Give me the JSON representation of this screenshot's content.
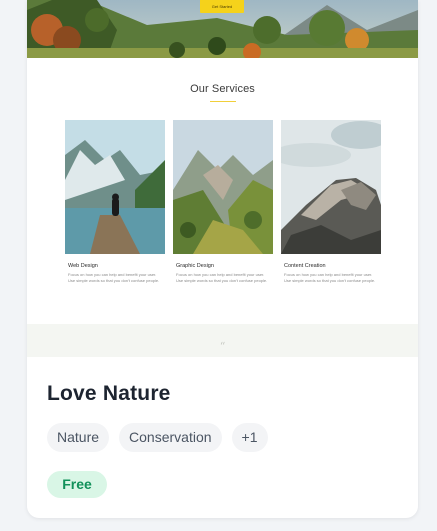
{
  "preview": {
    "hero_button_label": "Get Started",
    "services_title": "Our Services",
    "services": [
      {
        "title": "Web Design",
        "description": "Focus on how you can help and benefit your user. Use simple words so that you don't confuse people."
      },
      {
        "title": "Graphic Design",
        "description": "Focus on how you can help and benefit your user. Use simple words so that you don't confuse people."
      },
      {
        "title": "Content Creation",
        "description": "Focus on how you can help and benefit your user. Use simple words so that you don't confuse people."
      }
    ],
    "quote_mark": "“"
  },
  "item": {
    "title": "Love Nature",
    "tags": [
      "Nature",
      "Conservation",
      "+1"
    ],
    "price": "Free"
  },
  "colors": {
    "page_background": "#f2f4f7",
    "accent_yellow": "#f5d21b",
    "price_badge_bg": "#d9f6e6",
    "price_badge_text": "#11915a",
    "tag_bg": "#f3f4f6"
  },
  "icons": [
    "quote-icon"
  ]
}
